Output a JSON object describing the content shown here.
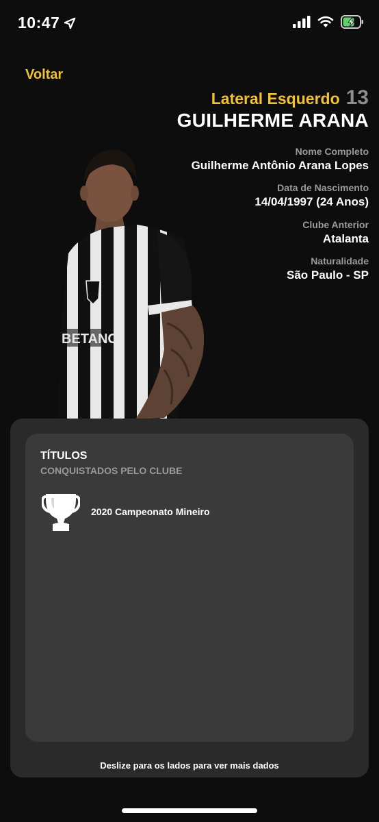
{
  "status_bar": {
    "time": "10:47",
    "icons": [
      "location-arrow-icon",
      "signal-icon",
      "wifi-icon",
      "battery-charging-icon"
    ]
  },
  "nav": {
    "back_label": "Voltar"
  },
  "player": {
    "position": "Lateral Esquerdo",
    "number": "13",
    "name": "GUILHERME ARANA",
    "details": [
      {
        "label": "Nome Completo",
        "value": "Guilherme Antônio Arana Lopes"
      },
      {
        "label": "Data de Nascimento",
        "value": "14/04/1997 (24 Anos)"
      },
      {
        "label": "Clube Anterior",
        "value": "Atalanta"
      },
      {
        "label": "Naturalidade",
        "value": "São Paulo - SP"
      }
    ]
  },
  "titles_card": {
    "title": "TÍTULOS",
    "subtitle": "CONQUISTADOS PELO CLUBE",
    "items": [
      {
        "icon": "trophy-icon",
        "label": "2020 Campeonato Mineiro"
      }
    ],
    "hint": "Deslize para os lados para ver mais dados"
  },
  "colors": {
    "accent": "#f2c230",
    "background": "#0d0d0d",
    "card": "#2a2a2a",
    "card_inner": "#3a3a3a",
    "muted": "#9a9a9a"
  }
}
